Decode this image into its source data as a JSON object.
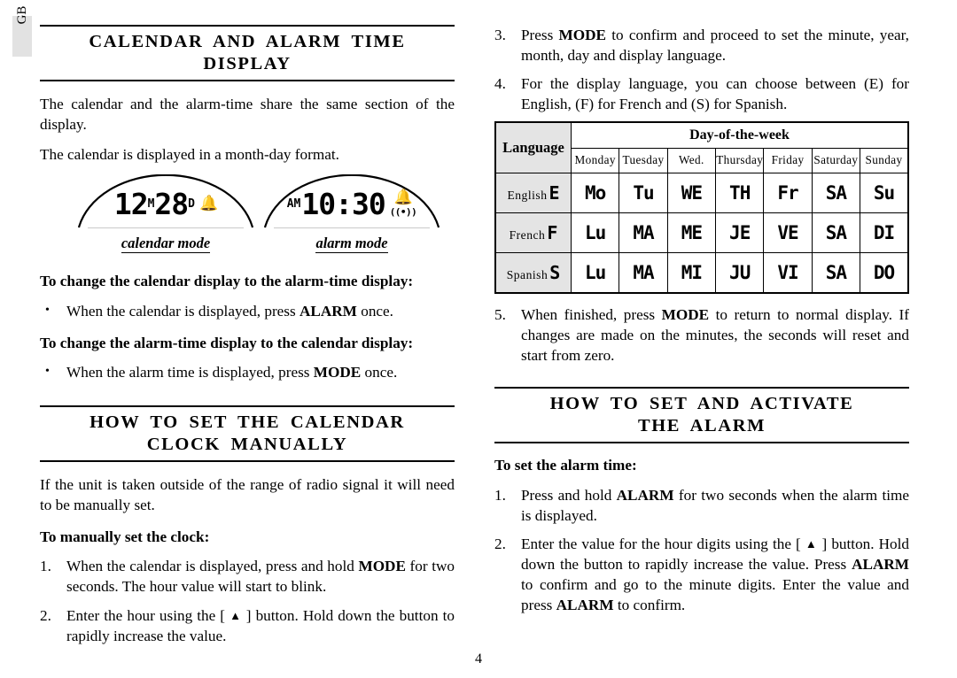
{
  "page": {
    "locale_tab": "GB",
    "number": "4"
  },
  "left_column": {
    "section1": {
      "heading_lines": [
        "CALENDAR AND ALARM TIME DISPLAY"
      ],
      "paragraphs": [
        "The calendar and the alarm-time share the same section of the display.",
        "The calendar is displayed in a month-day format."
      ],
      "displays": [
        {
          "name": "calendar-mode-display",
          "caption": "calendar mode",
          "value": "12",
          "value_unit": "M",
          "value2": "28",
          "value2_unit": "D",
          "bell_icon": "bell-icon",
          "wave_icon": ""
        },
        {
          "name": "alarm-mode-display",
          "caption": "alarm mode",
          "meridiem": "AM",
          "time": "10:30",
          "bell_icon": "bell-icon",
          "wave_icon": "((•))"
        }
      ],
      "sub1": {
        "heading": "To change the calendar display to the alarm-time display:",
        "bullets": [
          {
            "marker": "•",
            "parts": [
              {
                "t": "When the calendar is displayed, press ",
                "b": false
              },
              {
                "t": "ALARM",
                "b": true
              },
              {
                "t": " once.",
                "b": false
              }
            ]
          }
        ]
      },
      "sub2": {
        "heading": "To change the alarm-time display to the calendar display:",
        "bullets": [
          {
            "marker": "•",
            "parts": [
              {
                "t": "When the alarm time is displayed, press ",
                "b": false
              },
              {
                "t": "MODE",
                "b": true
              },
              {
                "t": " once.",
                "b": false
              }
            ]
          }
        ]
      }
    },
    "section2": {
      "heading_lines": [
        "HOW TO SET THE CALENDAR",
        "CLOCK MANUALLY"
      ],
      "intro": "If the unit is taken outside of the range of radio signal it will need to be manually set.",
      "sub_heading": "To manually set the clock:",
      "steps": [
        {
          "marker": "1.",
          "parts": [
            {
              "t": "When the calendar is displayed, press and hold ",
              "b": false
            },
            {
              "t": "MODE",
              "b": true
            },
            {
              "t": " for two seconds. The hour value will start to blink.",
              "b": false
            }
          ]
        },
        {
          "marker": "2.",
          "parts": [
            {
              "t": "Enter the hour using the [ ",
              "b": false
            },
            {
              "t": "▲",
              "b": false,
              "tri": true
            },
            {
              "t": " ] button. Hold down the button to rapidly increase the value.",
              "b": false
            }
          ]
        }
      ]
    }
  },
  "right_column": {
    "steps_top": [
      {
        "marker": "3.",
        "parts": [
          {
            "t": "Press ",
            "b": false
          },
          {
            "t": "MODE",
            "b": true
          },
          {
            "t": " to confirm and proceed to set the minute, year, month, day and display language.",
            "b": false
          }
        ]
      },
      {
        "marker": "4.",
        "parts": [
          {
            "t": "For the display language, you can choose between (E) for English, (F) for French and (S) for Spanish.",
            "b": false
          }
        ]
      }
    ],
    "table": {
      "language_header": "Language",
      "dow_header": "Day-of-the-week",
      "day_names": [
        "Monday",
        "Tuesday",
        "Wed.",
        "Thursday",
        "Friday",
        "Saturday",
        "Sunday"
      ],
      "rows": [
        {
          "language": "English",
          "code_glyph": "E",
          "days": [
            "Mo",
            "Tu",
            "WE",
            "TH",
            "Fr",
            "SA",
            "Su"
          ]
        },
        {
          "language": "French",
          "code_glyph": "F",
          "days": [
            "Lu",
            "MA",
            "ME",
            "JE",
            "VE",
            "SA",
            "DI"
          ]
        },
        {
          "language": "Spanish",
          "code_glyph": "S",
          "days": [
            "Lu",
            "MA",
            "MI",
            "JU",
            "VI",
            "SA",
            "DO"
          ]
        }
      ]
    },
    "steps_bottom": [
      {
        "marker": "5.",
        "parts": [
          {
            "t": "When finished, press ",
            "b": false
          },
          {
            "t": "MODE",
            "b": true
          },
          {
            "t": " to return to normal display.  If changes are made on the minutes, the seconds will reset and start from zero.",
            "b": false
          }
        ]
      }
    ],
    "section": {
      "heading_lines": [
        "HOW TO SET AND ACTIVATE",
        "THE ALARM"
      ],
      "sub_heading": "To set the alarm time:",
      "steps": [
        {
          "marker": "1.",
          "parts": [
            {
              "t": "Press and hold ",
              "b": false
            },
            {
              "t": "ALARM",
              "b": true
            },
            {
              "t": " for two seconds when the alarm time is displayed.",
              "b": false
            }
          ]
        },
        {
          "marker": "2.",
          "parts": [
            {
              "t": "Enter the value for the hour digits using the [ ",
              "b": false
            },
            {
              "t": "▲",
              "b": false,
              "tri": true
            },
            {
              "t": " ] button. Hold down the button to rapidly increase the value. Press ",
              "b": false
            },
            {
              "t": "ALARM",
              "b": true
            },
            {
              "t": " to confirm and go to the minute digits.  Enter the value and press ",
              "b": false
            },
            {
              "t": "ALARM",
              "b": true
            },
            {
              "t": " to confirm.",
              "b": false
            }
          ]
        }
      ]
    }
  }
}
